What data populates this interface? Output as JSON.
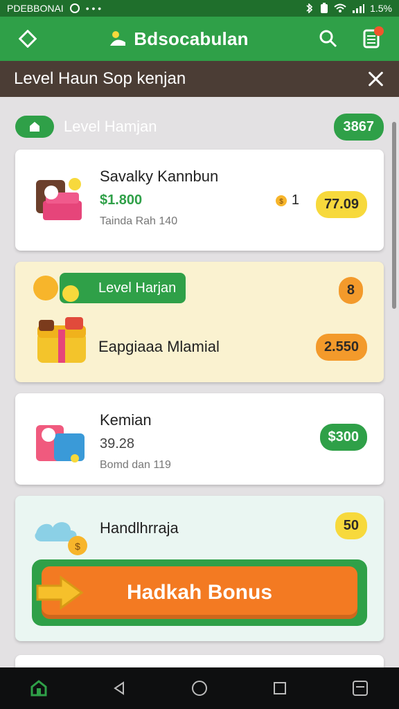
{
  "status_bar": {
    "left_text": "PDEBBONAI",
    "right_text": "1.5%"
  },
  "app_bar": {
    "title": "Bdsocabulan"
  },
  "subheader": {
    "title": "Level Haun Sop kenjan"
  },
  "section": {
    "title": "Level Hamjan",
    "count": "3867"
  },
  "cards": [
    {
      "title": "Savalky Kannbun",
      "price": "$1.800",
      "subtitle": "Tainda Rah 140",
      "coin_count": "1",
      "badge": "77.09"
    },
    {
      "level_label": "Level Harjan",
      "small_badge": "8",
      "title": "Eapgiaaa Mlamial",
      "badge": "2.550"
    },
    {
      "title": "Kemian",
      "price": "39.28",
      "subtitle": "Bomd dan 119",
      "badge": "$300"
    },
    {
      "title": "Handlhrraja",
      "badge": "50",
      "bonus_label": "Hadkah Bonus"
    }
  ],
  "colors": {
    "primary": "#2fa048",
    "dark_header": "#4b3d35",
    "accent_orange": "#f37a22",
    "badge_yellow": "#f7d93c"
  },
  "icons": [
    "diamond-icon",
    "search-icon",
    "notification-icon",
    "close-icon",
    "home-icon",
    "back-icon",
    "home-circle-icon",
    "recent-icon",
    "menu-icon"
  ]
}
